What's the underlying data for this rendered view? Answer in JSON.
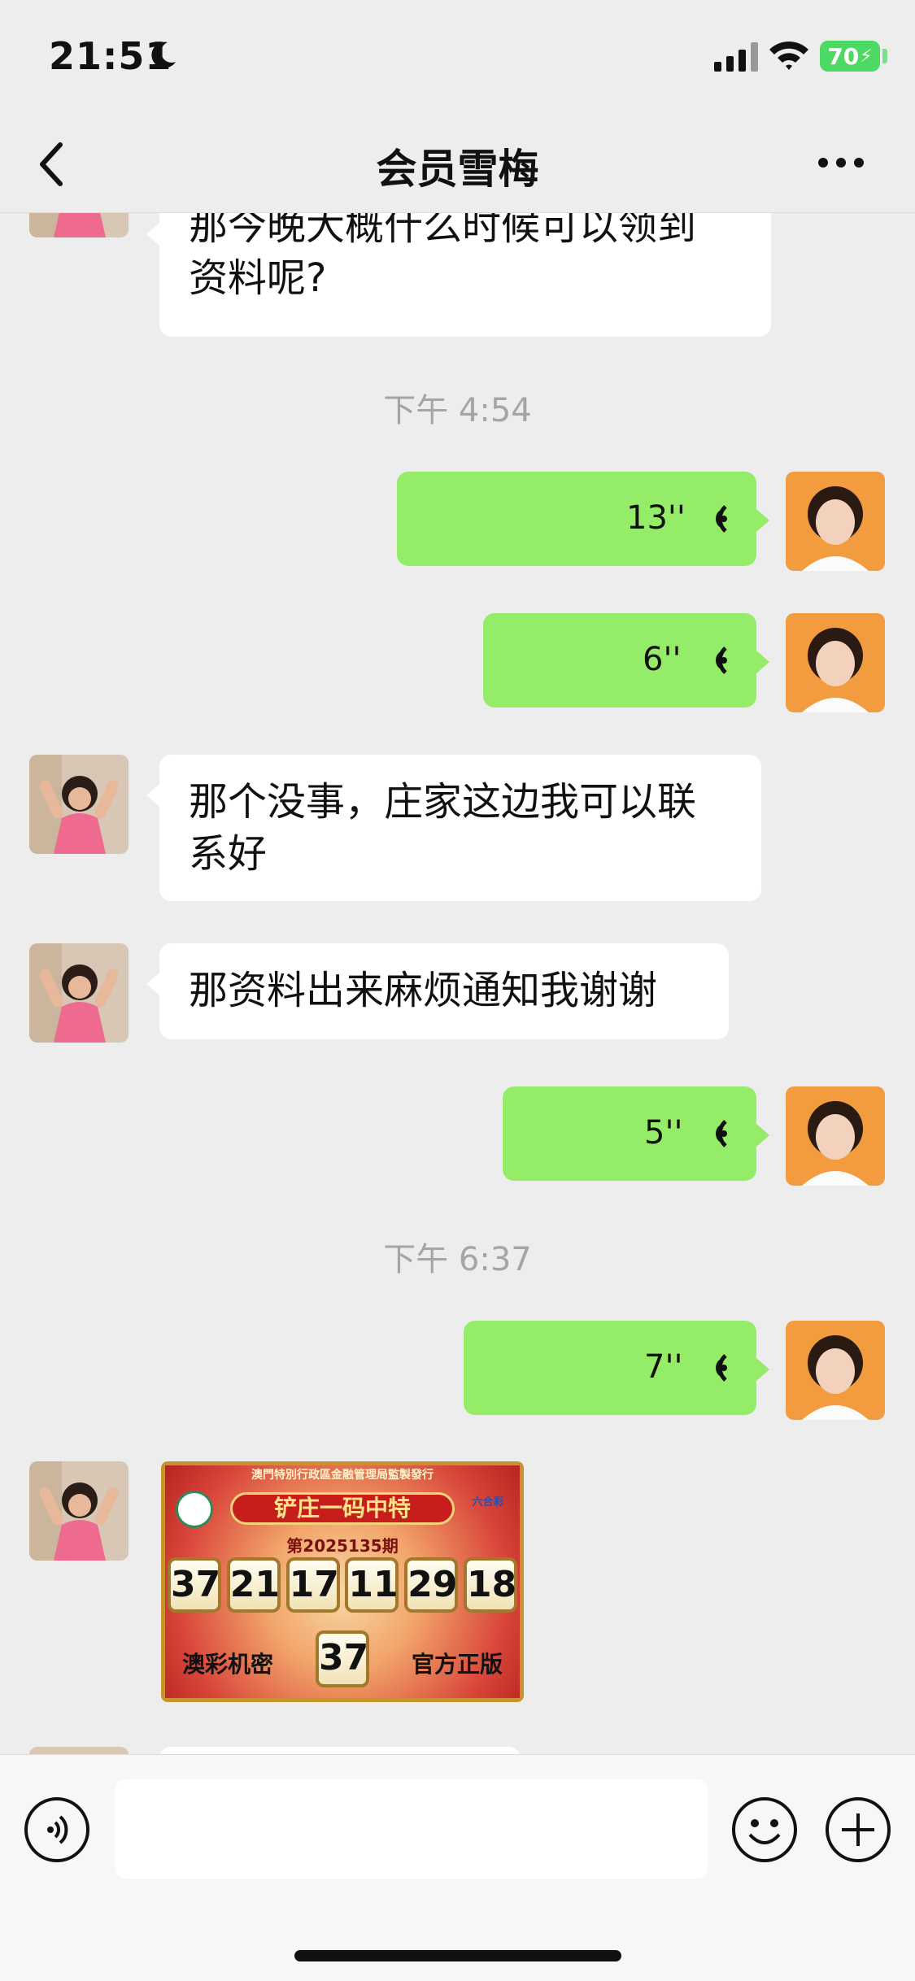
{
  "status_bar": {
    "time": "21:51",
    "battery": "70"
  },
  "header": {
    "title": "会员雪梅"
  },
  "messages": {
    "m1": {
      "text_line1": "那今晚大概什么时候可以领到",
      "text_line2": "资料呢?"
    },
    "t1": "下午 4:54",
    "v1": {
      "duration": "13''"
    },
    "v2": {
      "duration": "6''"
    },
    "m2": {
      "text_line1": "那个没事，庄家这边我可以联",
      "text_line2": "系好"
    },
    "m3": {
      "text": "那资料出来麻烦通知我谢谢"
    },
    "v3": {
      "duration": "5''"
    },
    "t2": "下午 6:37",
    "v4": {
      "duration": "7''"
    },
    "image": {
      "top_text": "澳門特別行政區金融管理局監製發行",
      "banner": "铲庄一码中特",
      "logo_text": "六合彩",
      "issue": "第2025135期",
      "numbers": [
        "37",
        "21",
        "17",
        "11",
        "29",
        "18"
      ],
      "special": "37",
      "bottom_left": "澳彩机密",
      "bottom_right": "官方正版"
    }
  },
  "input": {
    "placeholder": ""
  },
  "colors": {
    "outgoing_bubble": "#95ec69",
    "incoming_bubble": "#ffffff",
    "background": "#ededed"
  }
}
